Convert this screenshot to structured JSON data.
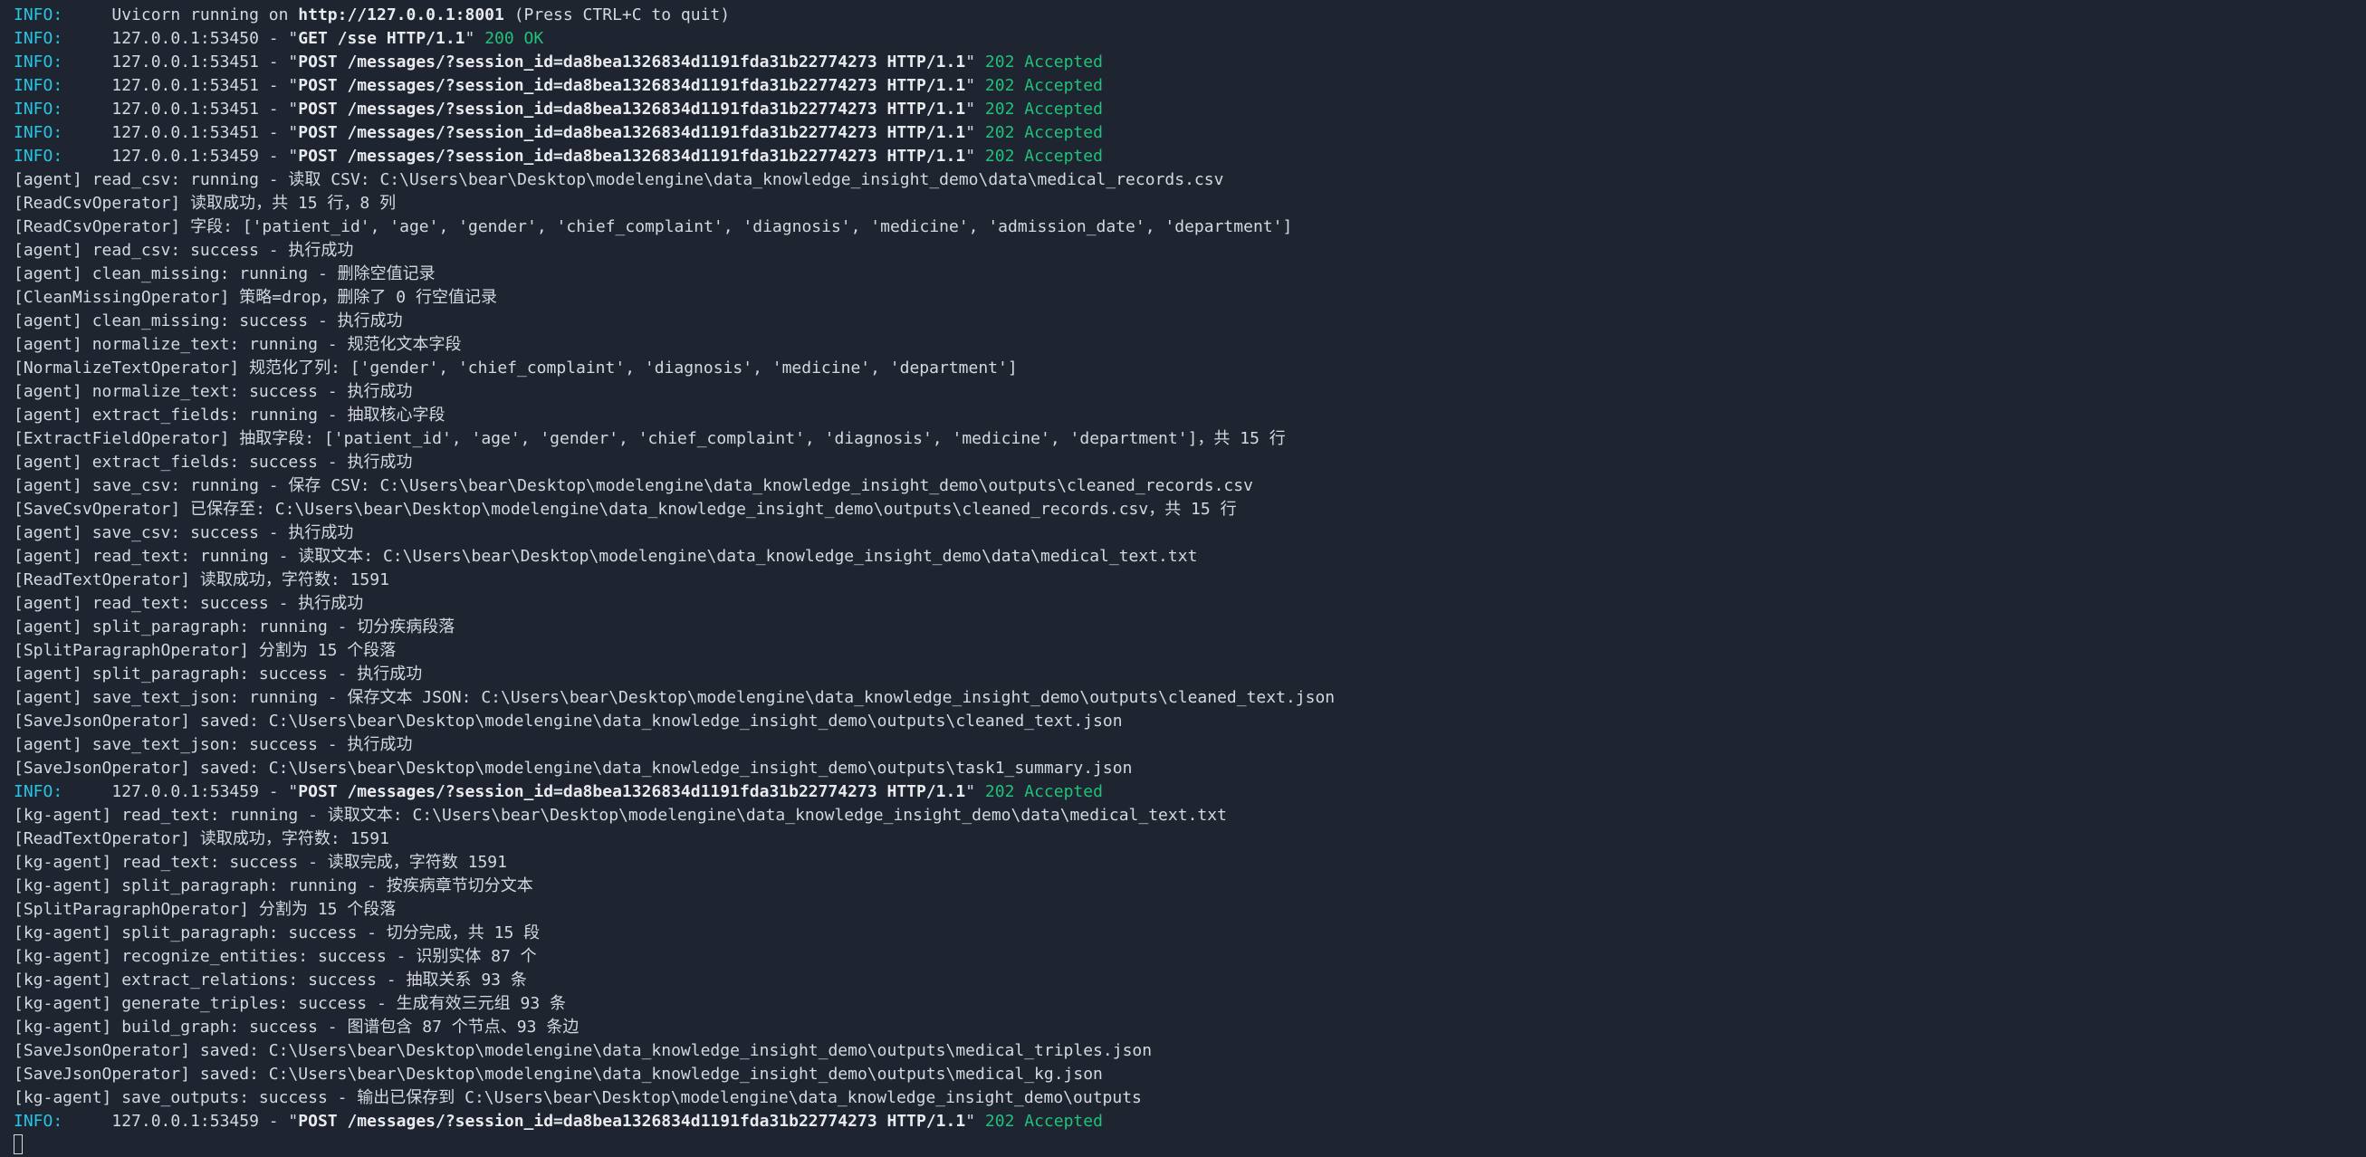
{
  "lines": [
    {
      "kind": "info",
      "seg": [
        "INFO:",
        "     Uvicorn running on ",
        "http://127.0.0.1:8001",
        " (Press CTRL+C to quit)"
      ]
    },
    {
      "kind": "req",
      "seg": [
        "INFO:",
        "     127.0.0.1:53450 - \"",
        "GET /sse HTTP/1.1",
        "\" ",
        "200 OK"
      ]
    },
    {
      "kind": "req",
      "seg": [
        "INFO:",
        "     127.0.0.1:53451 - \"",
        "POST /messages/?session_id=da8bea1326834d1191fda31b22774273 HTTP/1.1",
        "\" ",
        "202 Accepted"
      ]
    },
    {
      "kind": "req",
      "seg": [
        "INFO:",
        "     127.0.0.1:53451 - \"",
        "POST /messages/?session_id=da8bea1326834d1191fda31b22774273 HTTP/1.1",
        "\" ",
        "202 Accepted"
      ]
    },
    {
      "kind": "req",
      "seg": [
        "INFO:",
        "     127.0.0.1:53451 - \"",
        "POST /messages/?session_id=da8bea1326834d1191fda31b22774273 HTTP/1.1",
        "\" ",
        "202 Accepted"
      ]
    },
    {
      "kind": "req",
      "seg": [
        "INFO:",
        "     127.0.0.1:53451 - \"",
        "POST /messages/?session_id=da8bea1326834d1191fda31b22774273 HTTP/1.1",
        "\" ",
        "202 Accepted"
      ]
    },
    {
      "kind": "req",
      "seg": [
        "INFO:",
        "     127.0.0.1:53459 - \"",
        "POST /messages/?session_id=da8bea1326834d1191fda31b22774273 HTTP/1.1",
        "\" ",
        "202 Accepted"
      ]
    },
    {
      "kind": "plain",
      "text": "[agent] read_csv: running - 读取 CSV: C:\\Users\\bear\\Desktop\\modelengine\\data_knowledge_insight_demo\\data\\medical_records.csv"
    },
    {
      "kind": "plain",
      "text": "[ReadCsvOperator] 读取成功，共 15 行，8 列"
    },
    {
      "kind": "plain",
      "text": "[ReadCsvOperator] 字段: ['patient_id', 'age', 'gender', 'chief_complaint', 'diagnosis', 'medicine', 'admission_date', 'department']"
    },
    {
      "kind": "plain",
      "text": "[agent] read_csv: success - 执行成功"
    },
    {
      "kind": "plain",
      "text": "[agent] clean_missing: running - 删除空值记录"
    },
    {
      "kind": "plain",
      "text": "[CleanMissingOperator] 策略=drop，删除了 0 行空值记录"
    },
    {
      "kind": "plain",
      "text": "[agent] clean_missing: success - 执行成功"
    },
    {
      "kind": "plain",
      "text": "[agent] normalize_text: running - 规范化文本字段"
    },
    {
      "kind": "plain",
      "text": "[NormalizeTextOperator] 规范化了列: ['gender', 'chief_complaint', 'diagnosis', 'medicine', 'department']"
    },
    {
      "kind": "plain",
      "text": "[agent] normalize_text: success - 执行成功"
    },
    {
      "kind": "plain",
      "text": "[agent] extract_fields: running - 抽取核心字段"
    },
    {
      "kind": "plain",
      "text": "[ExtractFieldOperator] 抽取字段: ['patient_id', 'age', 'gender', 'chief_complaint', 'diagnosis', 'medicine', 'department']，共 15 行"
    },
    {
      "kind": "plain",
      "text": "[agent] extract_fields: success - 执行成功"
    },
    {
      "kind": "plain",
      "text": "[agent] save_csv: running - 保存 CSV: C:\\Users\\bear\\Desktop\\modelengine\\data_knowledge_insight_demo\\outputs\\cleaned_records.csv"
    },
    {
      "kind": "plain",
      "text": "[SaveCsvOperator] 已保存至: C:\\Users\\bear\\Desktop\\modelengine\\data_knowledge_insight_demo\\outputs\\cleaned_records.csv，共 15 行"
    },
    {
      "kind": "plain",
      "text": "[agent] save_csv: success - 执行成功"
    },
    {
      "kind": "plain",
      "text": "[agent] read_text: running - 读取文本: C:\\Users\\bear\\Desktop\\modelengine\\data_knowledge_insight_demo\\data\\medical_text.txt"
    },
    {
      "kind": "plain",
      "text": "[ReadTextOperator] 读取成功，字符数: 1591"
    },
    {
      "kind": "plain",
      "text": "[agent] read_text: success - 执行成功"
    },
    {
      "kind": "plain",
      "text": "[agent] split_paragraph: running - 切分疾病段落"
    },
    {
      "kind": "plain",
      "text": "[SplitParagraphOperator] 分割为 15 个段落"
    },
    {
      "kind": "plain",
      "text": "[agent] split_paragraph: success - 执行成功"
    },
    {
      "kind": "plain",
      "text": "[agent] save_text_json: running - 保存文本 JSON: C:\\Users\\bear\\Desktop\\modelengine\\data_knowledge_insight_demo\\outputs\\cleaned_text.json"
    },
    {
      "kind": "plain",
      "text": "[SaveJsonOperator] saved: C:\\Users\\bear\\Desktop\\modelengine\\data_knowledge_insight_demo\\outputs\\cleaned_text.json"
    },
    {
      "kind": "plain",
      "text": "[agent] save_text_json: success - 执行成功"
    },
    {
      "kind": "plain",
      "text": "[SaveJsonOperator] saved: C:\\Users\\bear\\Desktop\\modelengine\\data_knowledge_insight_demo\\outputs\\task1_summary.json"
    },
    {
      "kind": "req",
      "seg": [
        "INFO:",
        "     127.0.0.1:53459 - \"",
        "POST /messages/?session_id=da8bea1326834d1191fda31b22774273 HTTP/1.1",
        "\" ",
        "202 Accepted"
      ]
    },
    {
      "kind": "plain",
      "text": "[kg-agent] read_text: running - 读取文本: C:\\Users\\bear\\Desktop\\modelengine\\data_knowledge_insight_demo\\data\\medical_text.txt"
    },
    {
      "kind": "plain",
      "text": "[ReadTextOperator] 读取成功，字符数: 1591"
    },
    {
      "kind": "plain",
      "text": "[kg-agent] read_text: success - 读取完成，字符数 1591"
    },
    {
      "kind": "plain",
      "text": "[kg-agent] split_paragraph: running - 按疾病章节切分文本"
    },
    {
      "kind": "plain",
      "text": "[SplitParagraphOperator] 分割为 15 个段落"
    },
    {
      "kind": "plain",
      "text": "[kg-agent] split_paragraph: success - 切分完成，共 15 段"
    },
    {
      "kind": "plain",
      "text": "[kg-agent] recognize_entities: success - 识别实体 87 个"
    },
    {
      "kind": "plain",
      "text": "[kg-agent] extract_relations: success - 抽取关系 93 条"
    },
    {
      "kind": "plain",
      "text": "[kg-agent] generate_triples: success - 生成有效三元组 93 条"
    },
    {
      "kind": "plain",
      "text": "[kg-agent] build_graph: success - 图谱包含 87 个节点、93 条边"
    },
    {
      "kind": "plain",
      "text": "[SaveJsonOperator] saved: C:\\Users\\bear\\Desktop\\modelengine\\data_knowledge_insight_demo\\outputs\\medical_triples.json"
    },
    {
      "kind": "plain",
      "text": "[SaveJsonOperator] saved: C:\\Users\\bear\\Desktop\\modelengine\\data_knowledge_insight_demo\\outputs\\medical_kg.json"
    },
    {
      "kind": "plain",
      "text": "[kg-agent] save_outputs: success - 输出已保存到 C:\\Users\\bear\\Desktop\\modelengine\\data_knowledge_insight_demo\\outputs"
    },
    {
      "kind": "req",
      "seg": [
        "INFO:",
        "     127.0.0.1:53459 - \"",
        "POST /messages/?session_id=da8bea1326834d1191fda31b22774273 HTTP/1.1",
        "\" ",
        "202 Accepted"
      ]
    }
  ],
  "colors": {
    "background": "#1e2430",
    "text": "#d5d8de",
    "info_label": "#26c6e6",
    "status_ok": "#21c17a"
  }
}
